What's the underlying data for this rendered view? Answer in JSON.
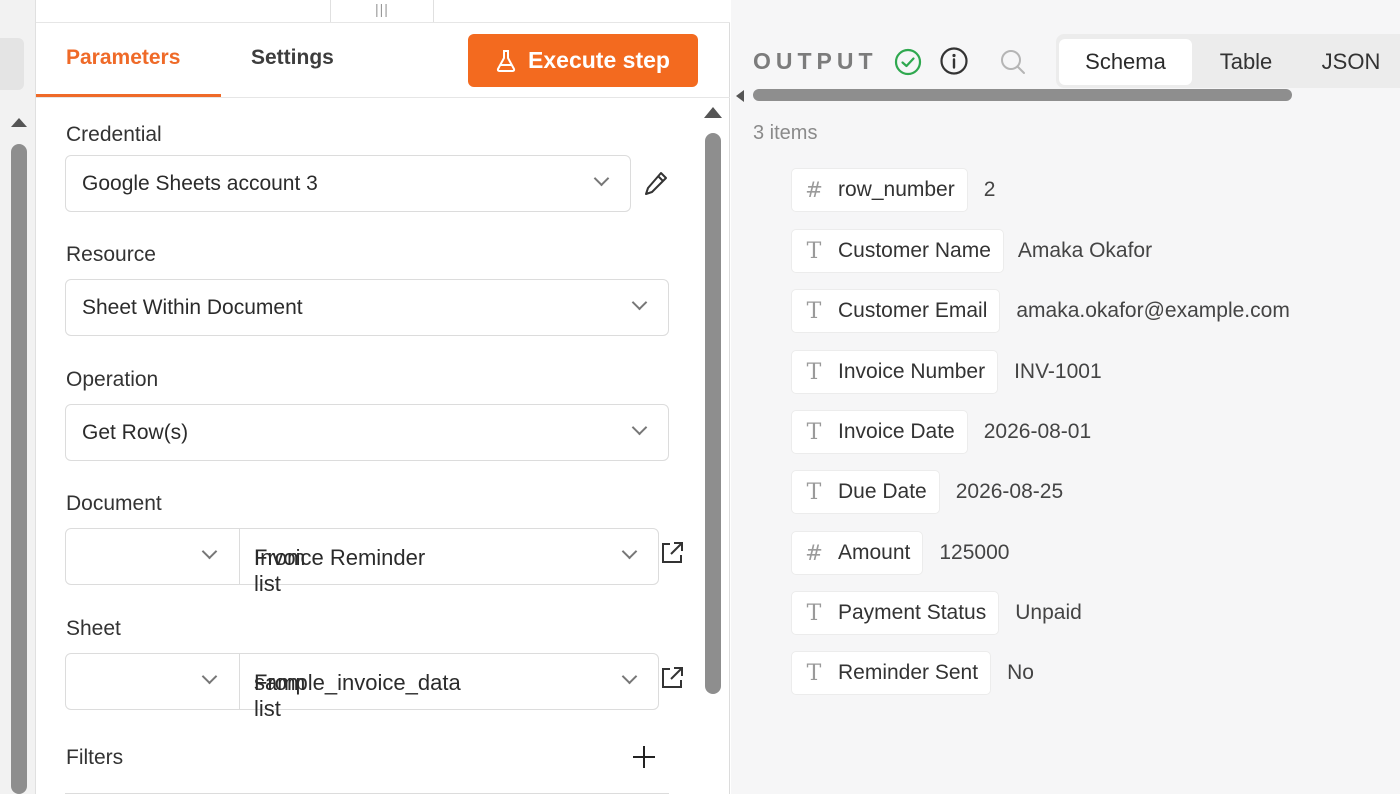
{
  "top_handle": "|||",
  "tabs": {
    "parameters": "Parameters",
    "settings": "Settings"
  },
  "execute_button": "Execute step",
  "fields": {
    "credential": {
      "label": "Credential",
      "value": "Google Sheets account 3"
    },
    "resource": {
      "label": "Resource",
      "value": "Sheet Within Document"
    },
    "operation": {
      "label": "Operation",
      "value": "Get Row(s)"
    },
    "document": {
      "label": "Document",
      "mode": "From list",
      "value": "Invoice Reminder"
    },
    "sheet": {
      "label": "Sheet",
      "mode": "From list",
      "value": "sample_invoice_data"
    },
    "filters": {
      "label": "Filters"
    }
  },
  "output": {
    "title": "OUTPUT",
    "view_tabs": [
      "Schema",
      "Table",
      "JSON"
    ],
    "active_view": "Schema",
    "item_count": "3 items",
    "rows": [
      {
        "type": "#",
        "key": "row_number",
        "value": "2"
      },
      {
        "type": "T",
        "key": "Customer Name",
        "value": "Amaka Okafor"
      },
      {
        "type": "T",
        "key": "Customer Email",
        "value": "amaka.okafor@example.com"
      },
      {
        "type": "T",
        "key": "Invoice Number",
        "value": "INV-1001"
      },
      {
        "type": "T",
        "key": "Invoice Date",
        "value": "2026-08-01"
      },
      {
        "type": "T",
        "key": "Due Date",
        "value": "2026-08-25"
      },
      {
        "type": "#",
        "key": "Amount",
        "value": "125000"
      },
      {
        "type": "T",
        "key": "Payment Status",
        "value": "Unpaid"
      },
      {
        "type": "T",
        "key": "Reminder Sent",
        "value": "No"
      }
    ]
  },
  "colors": {
    "accent": "#ef6a28",
    "button": "#f36a1f",
    "success": "#2fa84f"
  },
  "icons": [
    "flask-icon",
    "pencil-icon",
    "external-link-icon",
    "check-circle-icon",
    "info-icon",
    "search-icon",
    "plus-icon",
    "chevron-down-icon"
  ]
}
